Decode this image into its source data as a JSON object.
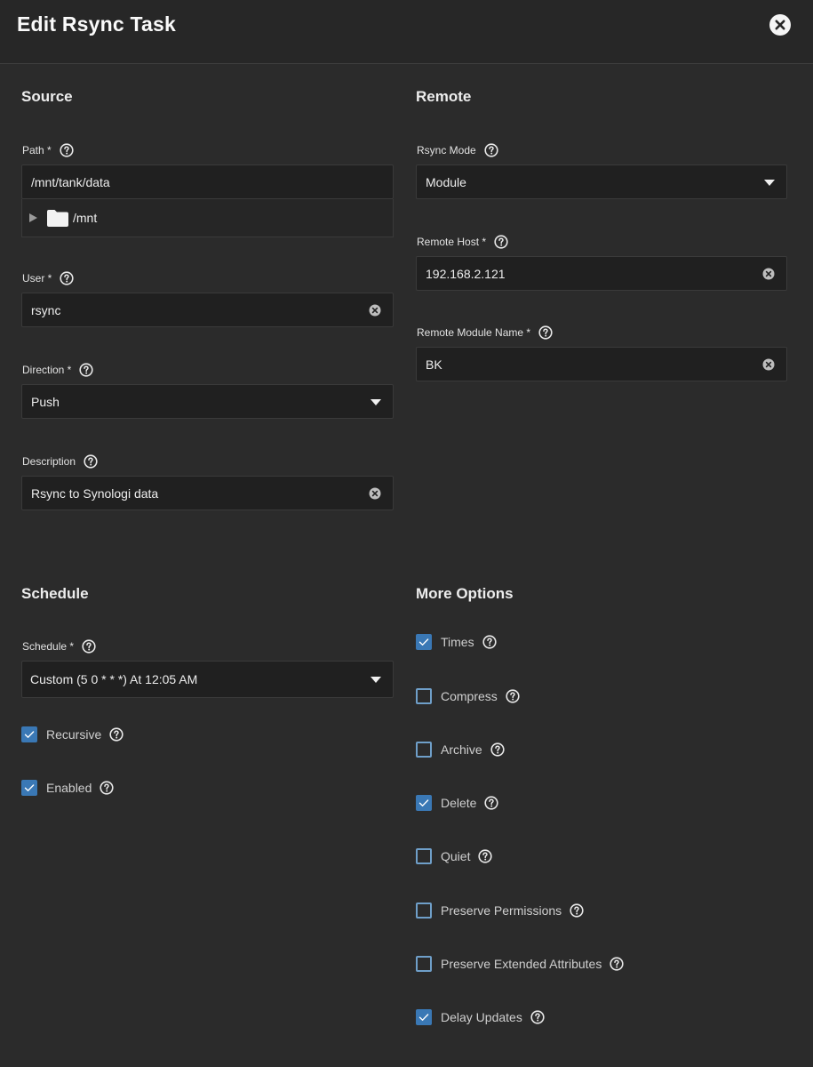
{
  "dialog": {
    "title": "Edit Rsync Task"
  },
  "source": {
    "title": "Source",
    "path": {
      "label": "Path *",
      "value": "/mnt/tank/data",
      "tree_item": "/mnt"
    },
    "user": {
      "label": "User *",
      "value": "rsync"
    },
    "direction": {
      "label": "Direction *",
      "value": "Push"
    },
    "description": {
      "label": "Description",
      "value": "Rsync to Synologi data"
    }
  },
  "remote": {
    "title": "Remote",
    "mode": {
      "label": "Rsync Mode",
      "value": "Module"
    },
    "host": {
      "label": "Remote Host *",
      "value": "192.168.2.121"
    },
    "module": {
      "label": "Remote Module Name *",
      "value": "BK"
    }
  },
  "schedule": {
    "title": "Schedule",
    "schedule": {
      "label": "Schedule *",
      "value": "Custom (5 0 * * *) At 12:05 AM"
    },
    "recursive": {
      "label": "Recursive",
      "checked": true
    },
    "enabled": {
      "label": "Enabled",
      "checked": true
    }
  },
  "options": {
    "title": "More Options",
    "items": [
      {
        "label": "Times",
        "checked": true
      },
      {
        "label": "Compress",
        "checked": false
      },
      {
        "label": "Archive",
        "checked": false
      },
      {
        "label": "Delete",
        "checked": true
      },
      {
        "label": "Quiet",
        "checked": false
      },
      {
        "label": "Preserve Permissions",
        "checked": false
      },
      {
        "label": "Preserve Extended Attributes",
        "checked": false
      },
      {
        "label": "Delay Updates",
        "checked": true
      }
    ]
  },
  "colors": {
    "accent": "#3a78b5",
    "background": "#2b2b2b",
    "field": "#202020"
  },
  "icons": {
    "close": "close-circle-icon",
    "help": "help-circle-icon",
    "clear": "clear-circle-icon",
    "caret": "caret-down-icon",
    "folder": "folder-icon",
    "expand": "expand-triangle-icon",
    "check": "checkmark-icon"
  }
}
